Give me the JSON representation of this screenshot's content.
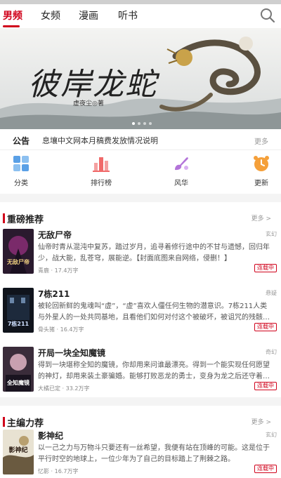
{
  "tabs": [
    {
      "label": "男频",
      "active": true
    },
    {
      "label": "女频",
      "active": false
    },
    {
      "label": "漫画",
      "active": false
    },
    {
      "label": "听书",
      "active": false
    }
  ],
  "banner": {
    "title": "彼岸龙蛇",
    "subtitle": "虚夜尘◎著"
  },
  "notice": {
    "label": "公告",
    "text": "息壤中文网本月稿费发放情况说明",
    "more": "更多"
  },
  "categories": [
    {
      "label": "分类",
      "icon": "grid-icon",
      "color": "#5aa0e6"
    },
    {
      "label": "排行榜",
      "icon": "ranking-icon",
      "color": "#f06a6a"
    },
    {
      "label": "风华",
      "icon": "brush-icon",
      "color": "#b374d9"
    },
    {
      "label": "更新",
      "icon": "clock-icon",
      "color": "#f5a03a"
    }
  ],
  "section1": {
    "title": "重磅推荐",
    "more": "更多 >",
    "books": [
      {
        "title": "无敌尸帝",
        "category": "玄幻",
        "desc": "仙帝时青从混沌中复苏，踏过岁月，追寻着修行途中的不甘与遗憾，回归年少，战大能，乱苍穹，展能逆。【封面底图来自网络，侵删！】",
        "meta": "青鹿 · 17.4万字",
        "btn": "连载中",
        "cover_text": "无敌尸帝"
      },
      {
        "title": "7栋211",
        "category": "悬疑",
        "desc": "被轮回新鲜的鬼魂叫“虚”，“虚”喜欢人僵任何生物的潜意识。7栋211人类与外星人的一处共同基地，且看他们如何对付这个被破坏，被诅咒的残骸…",
        "meta": "骨头猪 · 16.4万字",
        "btn": "连载中",
        "cover_text": "7栋211"
      },
      {
        "title": "开局一块全知魔镜",
        "category": "奇幻",
        "desc": "得到一块堪称全知的魔镜，你却用来问谁最漂亮。得到一个能实现任何愿望的神灯，却用来装土豪骗婚。能够打败恶龙的勇士，变身为龙之后还守着…",
        "meta": "大橘已定 · 33.2万字",
        "btn": "连载中",
        "cover_text": "全知魔镜"
      }
    ]
  },
  "section2": {
    "title": "主编力荐",
    "more": "更多 >",
    "books": [
      {
        "title": "影神纪",
        "category": "玄幻",
        "desc": "以一己之力与万物斗只要还有一丝希望，我便有站在顶峰的可能。这是位于平行时空的地球上，一位少年为了自己的目标踏上了荆棘之路。",
        "meta": "忆影 · 16.7万字",
        "btn": "连载中",
        "cover_text": "影神纪"
      }
    ]
  },
  "colors": {
    "accent": "#d0021b"
  }
}
